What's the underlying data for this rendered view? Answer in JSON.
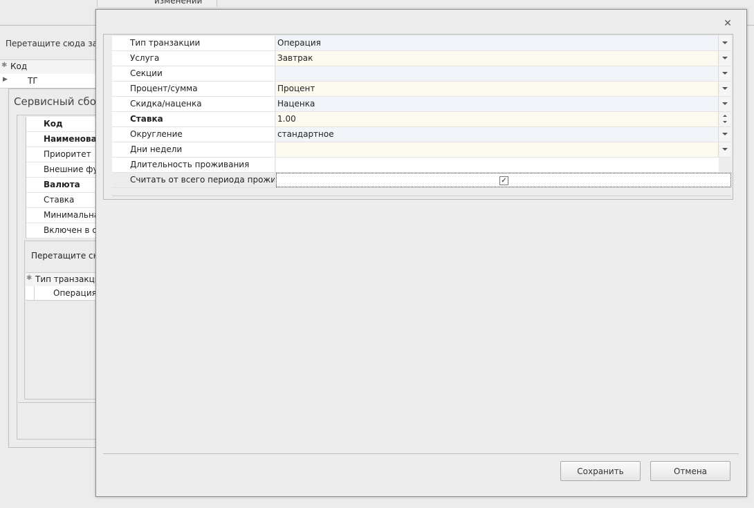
{
  "background": {
    "top_tab_text": "изменений",
    "drag_hint": "Перетащите сюда заг",
    "grid": {
      "header": "Код",
      "row_value": "ТГ"
    },
    "subpanel_title": "Сервисный сбор(",
    "props": [
      {
        "label": "Код",
        "bold": true
      },
      {
        "label": "Наименова",
        "bold": true
      },
      {
        "label": "Приоритет",
        "bold": false
      },
      {
        "label": "Внешние фун",
        "bold": false
      },
      {
        "label": "Валюта",
        "bold": true
      },
      {
        "label": "Ставка",
        "bold": false
      },
      {
        "label": "Минимальна",
        "bold": false
      },
      {
        "label": "Включен в ст",
        "bold": false
      }
    ],
    "inner_drag_hint": "Перетащите сю",
    "inner_grid": {
      "header": "Тип транзакци",
      "row_value": "Операция"
    }
  },
  "dialog": {
    "close_icon": "close-icon",
    "rows": [
      {
        "label": "Тип транзакции",
        "value": "Операция",
        "editor": "dropdown",
        "bg": "blue"
      },
      {
        "label": "Услуга",
        "value": "Завтрак",
        "editor": "dropdown",
        "bg": "cream"
      },
      {
        "label": "Секции",
        "value": "",
        "editor": "dropdown",
        "bg": "blue"
      },
      {
        "label": "Процент/сумма",
        "value": "Процент",
        "editor": "dropdown",
        "bg": "cream"
      },
      {
        "label": "Скидка/наценка",
        "value": "Наценка",
        "editor": "dropdown",
        "bg": "blue"
      },
      {
        "label": "Ставка",
        "value": "1.00",
        "editor": "spin",
        "bg": "cream",
        "bold": true
      },
      {
        "label": "Округление",
        "value": "стандартное",
        "editor": "dropdown",
        "bg": "blue"
      },
      {
        "label": "Дни недели",
        "value": "",
        "editor": "dropdown",
        "bg": "cream"
      },
      {
        "label": "Длительность проживания",
        "value": "",
        "editor": "none",
        "bg": "white"
      },
      {
        "label": "Считать от всего периода прожив",
        "value": "",
        "editor": "checkbox",
        "checked": true,
        "bg": "white"
      }
    ],
    "buttons": {
      "save": "Сохранить",
      "cancel": "Отмена"
    }
  }
}
